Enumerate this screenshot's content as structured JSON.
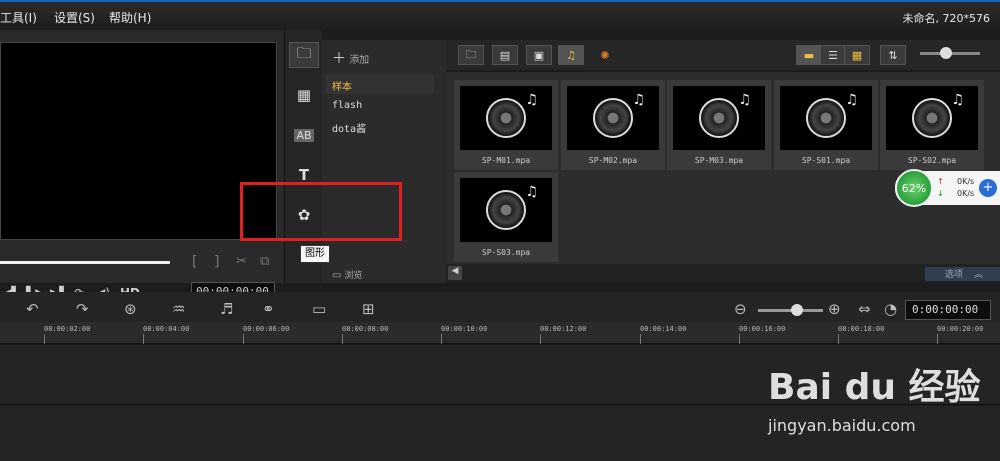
{
  "menu": {
    "tools": "工具(I)",
    "settings": "设置(S)",
    "help": "帮助(H)"
  },
  "project": {
    "info": "未命名, 720*576"
  },
  "preview": {
    "trim_left": "[",
    "trim_right": "]",
    "hd": "HD",
    "timecode": "00:00:00:00"
  },
  "library": {
    "add_label": "添加",
    "folders": [
      "样本",
      "flash",
      "dota酱"
    ],
    "browse_label": "浏览",
    "tooltip": "图形",
    "items": [
      "SP-M01.mpa",
      "SP-M02.mpa",
      "SP-M03.mpa",
      "SP-S01.mpa",
      "SP-S02.mpa",
      "SP-S03.mpa"
    ],
    "options_label": "选项"
  },
  "net_widget": {
    "percent": "62%",
    "up": "0K/s",
    "down": "0K/s"
  },
  "timeline": {
    "timecode": "0:00:00:00",
    "ticks": [
      "00:00:02:00",
      "00:00:04:00",
      "00:00:06:00",
      "00:00:08:00",
      "00:00:10:00",
      "00:00:12:00",
      "00:00:14:00",
      "00:00:16:00",
      "00:00:18:00",
      "00:00:20:00"
    ]
  },
  "watermark": {
    "logo": "Bai du 经验",
    "url": "jingyan.baidu.com"
  }
}
